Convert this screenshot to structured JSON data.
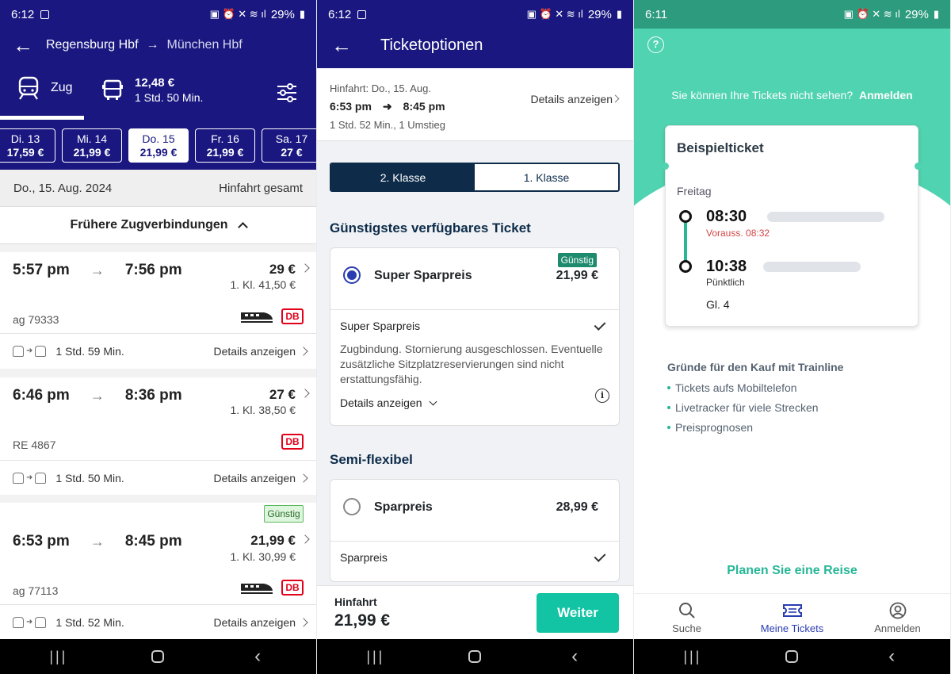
{
  "screen1": {
    "status": {
      "time": "6:12",
      "battery": "29%"
    },
    "route": {
      "from": "Regensburg Hbf",
      "arrow": "→",
      "to": "München Hbf"
    },
    "modes": {
      "train_label": "Zug",
      "bus_price": "12,48 €",
      "bus_duration": "1 Std. 50 Min."
    },
    "dates": [
      {
        "day": "Di. 13",
        "price": "17,59 €"
      },
      {
        "day": "Mi. 14",
        "price": "21,99 €"
      },
      {
        "day": "Do. 15",
        "price": "21,99 €"
      },
      {
        "day": "Fr. 16",
        "price": "21,99 €"
      },
      {
        "day": "Sa. 17",
        "price": "27 €"
      }
    ],
    "date_line": {
      "date": "Do., 15. Aug. 2024",
      "label": "Hinfahrt gesamt"
    },
    "earlier_label": "Frühere Zugverbindungen",
    "connections": [
      {
        "dep": "5:57 pm",
        "arr": "7:56 pm",
        "price": "29 €",
        "first_class": "1. Kl. 41,50 €",
        "train": "ag 79333",
        "duration": "1 Std. 59 Min.",
        "details": "Details anzeigen"
      },
      {
        "dep": "6:46 pm",
        "arr": "8:36 pm",
        "price": "27 €",
        "first_class": "1. Kl. 38,50 €",
        "train": "RE 4867",
        "duration": "1 Std. 50 Min.",
        "details": "Details anzeigen"
      },
      {
        "dep": "6:53 pm",
        "arr": "8:45 pm",
        "price": "21,99 €",
        "first_class": "1. Kl. 30,99 €",
        "train": "ag 77113",
        "duration": "1 Std. 52 Min.",
        "details": "Details anzeigen",
        "badge": "Günstig"
      }
    ],
    "db_logo": "DB"
  },
  "screen2": {
    "status": {
      "time": "6:12",
      "battery": "29%"
    },
    "title": "Ticketoptionen",
    "trip": {
      "label": "Hinfahrt: Do., 15. Aug.",
      "dep": "6:53 pm",
      "arr": "8:45 pm",
      "meta": "1 Std. 52 Min., 1 Umstieg",
      "details": "Details anzeigen"
    },
    "classes": {
      "second": "2. Klasse",
      "first": "1. Klasse"
    },
    "section1": "Günstigstes verfügbares Ticket",
    "ticket1": {
      "name": "Super Sparpreis",
      "price": "21,99 €",
      "badge": "Günstig",
      "sub": "Super Sparpreis",
      "desc": "Zugbindung. Stornierung ausgeschlossen. Eventuelle zusätzliche Sitzplatzreservierungen sind nicht erstattungsfähig.",
      "details": "Details anzeigen"
    },
    "section2": "Semi-flexibel",
    "ticket2": {
      "name": "Sparpreis",
      "price": "28,99 €",
      "sub": "Sparpreis"
    },
    "footer": {
      "label": "Hinfahrt",
      "amount": "21,99 €",
      "button": "Weiter"
    }
  },
  "screen3": {
    "status": {
      "time": "6:11",
      "battery": "29%"
    },
    "message": "Sie können Ihre Tickets nicht sehen?",
    "login_link": "Anmelden",
    "card": {
      "title": "Beispielticket",
      "day": "Freitag",
      "dep_time": "08:30",
      "dep_delay": "Vorauss. 08:32",
      "arr_time": "10:38",
      "arr_status": "Pünktlich",
      "platform": "Gl. 4"
    },
    "reasons": {
      "title": "Gründe für den Kauf mit Trainline",
      "items": [
        "Tickets aufs Mobiltelefon",
        "Livetracker für viele Strecken",
        "Preisprognosen"
      ]
    },
    "plan_link": "Planen Sie eine Reise",
    "tabs": {
      "search": "Suche",
      "tickets": "Meine Tickets",
      "login": "Anmelden"
    }
  },
  "colors": {
    "navy": "#1a1880",
    "dark_navy": "#0e2c4a",
    "teal": "#12c4a3",
    "mint": "#50d3b0",
    "db_red": "#e2001a",
    "accent_blue": "#2a3db0"
  }
}
